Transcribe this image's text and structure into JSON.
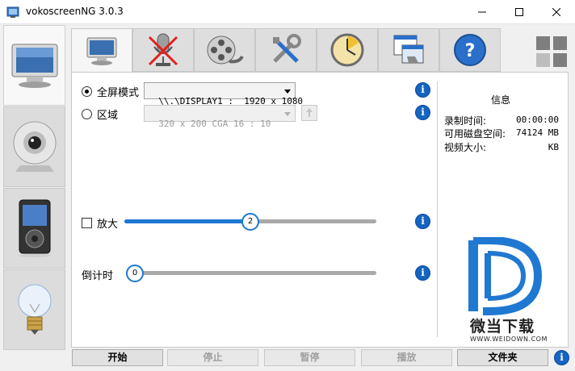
{
  "window": {
    "title": "vokoscreenNG 3.0.3",
    "controls": [
      "minimize",
      "maximize",
      "close"
    ]
  },
  "sidebar": {
    "items": [
      {
        "name": "screencast",
        "icon": "monitor-icon",
        "active": true
      },
      {
        "name": "camera",
        "icon": "webcam-icon",
        "active": false
      },
      {
        "name": "player",
        "icon": "media-player-icon",
        "active": false
      },
      {
        "name": "log",
        "icon": "lightbulb-icon",
        "active": false
      }
    ]
  },
  "tabs": [
    {
      "icon": "monitor-icon",
      "active": true
    },
    {
      "icon": "microphone-muted-icon",
      "active": false
    },
    {
      "icon": "film-reel-icon",
      "active": false
    },
    {
      "icon": "tools-icon",
      "active": false
    },
    {
      "icon": "timer-icon",
      "active": false
    },
    {
      "icon": "window-screenshot-icon",
      "active": false
    },
    {
      "icon": "help-icon",
      "active": false
    }
  ],
  "capture": {
    "fullscreen_label": "全屏模式",
    "display_value": "\\\\.\\DISPLAY1 :  1920 x 1080",
    "area_label": "区域",
    "area_value": "320 x 200 CGA 16 : 10",
    "magnifier_label": "放大",
    "magnifier_value": "2",
    "magnifier_fraction": 0.5,
    "countdown_label": "倒计时",
    "countdown_value": "0",
    "countdown_fraction": 0.0
  },
  "info": {
    "title": "信息",
    "rows": [
      {
        "key": "录制时间:",
        "value": "00:00:00"
      },
      {
        "key": "可用磁盘空间:",
        "value": "74124 MB"
      },
      {
        "key": "视频大小:",
        "value": "KB"
      }
    ]
  },
  "buttons": {
    "start": "开始",
    "stop": "停止",
    "pause": "暂停",
    "play": "播放",
    "folder": "文件夹"
  },
  "watermark": {
    "text": "微当下载",
    "url": "WWW.WEIDOWN.COM"
  },
  "colors": {
    "accent": "#1f78d1",
    "info_blue": "#1565c0"
  }
}
